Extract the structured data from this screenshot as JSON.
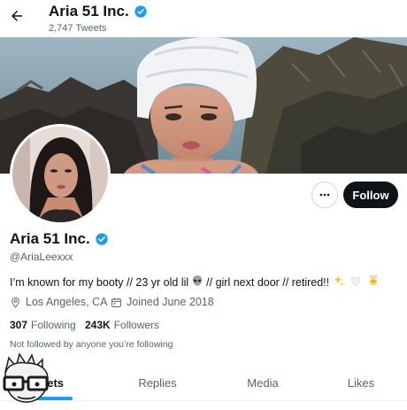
{
  "header": {
    "name": "Aria 51 Inc.",
    "tweet_count": "2,747",
    "tweet_count_label": "Tweets"
  },
  "actions": {
    "follow_label": "Follow"
  },
  "profile": {
    "name": "Aria 51 Inc.",
    "handle": "@AriaLeexxx",
    "bio_part1": "I’m known for my booty // 23 yr old lil",
    "bio_part2": "// girl next door // retired!!",
    "location": "Los Angeles, CA",
    "joined": "Joined June 2018",
    "following_count": "307",
    "following_label": "Following",
    "followers_count": "243K",
    "followers_label": "Followers",
    "not_followed": "Not followed by anyone you’re following",
    "icons": {
      "verified": "verified-badge-icon",
      "location": "location-pin-icon",
      "calendar": "calendar-icon",
      "back": "back-arrow-icon",
      "more": "more-dots-icon"
    }
  },
  "tabs": [
    {
      "label": "eets",
      "active": true
    },
    {
      "label": "Replies",
      "active": false
    },
    {
      "label": "Media",
      "active": false
    },
    {
      "label": "Likes",
      "active": false
    }
  ],
  "colors": {
    "accent": "#1d9bf0",
    "text": "#0f1419",
    "secondary": "#536471",
    "follow_bg": "#0f1419"
  }
}
